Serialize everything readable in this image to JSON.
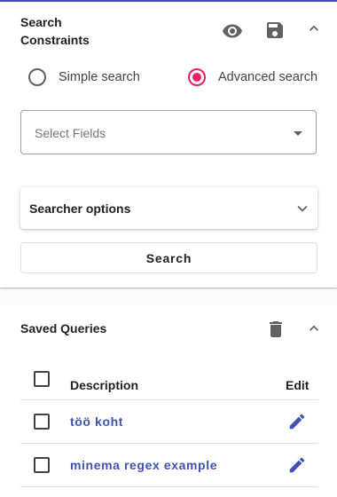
{
  "search_constraints": {
    "title": "Search Constraints",
    "icons": {
      "preview": "eye-icon",
      "save": "floppy-disk-icon",
      "collapse": "chevron-up-icon"
    },
    "mode": {
      "options": [
        {
          "label": "Simple search",
          "selected": false
        },
        {
          "label": "Advanced search",
          "selected": true
        }
      ]
    },
    "fields_select": {
      "label": "Select Fields",
      "value": ""
    },
    "searcher_options": {
      "title": "Searcher options",
      "expanded": false
    },
    "search_button": "Search"
  },
  "saved_queries": {
    "title": "Saved Queries",
    "icons": {
      "delete": "trash-icon",
      "collapse": "chevron-up-icon"
    },
    "table": {
      "headers": {
        "description": "Description",
        "edit": "Edit"
      },
      "rows": [
        {
          "description": "töö koht",
          "checked": false
        },
        {
          "description": "minema regex example",
          "checked": false
        }
      ]
    }
  },
  "colors": {
    "accent": "#3f51b5",
    "radio_selected": "#e91e63",
    "icon": "#616161"
  }
}
